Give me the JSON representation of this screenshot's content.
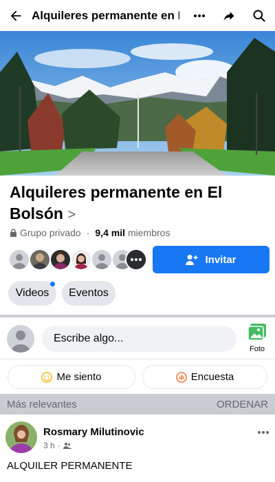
{
  "header": {
    "title": "Alquileres permanente en E...",
    "icons": [
      "back-arrow-icon",
      "more-dots-icon",
      "share-icon",
      "search-icon"
    ]
  },
  "group": {
    "name": "Alquileres permanente en El Bolsón",
    "chevron": ">",
    "privacy": "Grupo privado",
    "separator": "·",
    "member_count": "9,4 mil",
    "member_label": "miembros"
  },
  "invite_label": "Invitar",
  "tabs": [
    {
      "label": "Videos",
      "has_notification": true
    },
    {
      "label": "Eventos",
      "has_notification": false
    }
  ],
  "composer": {
    "placeholder": "Escribe algo...",
    "photo_label": "Foto"
  },
  "actions": {
    "feeling_label": "Me siento",
    "poll_label": "Encuesta"
  },
  "feed": {
    "sort_label": "Más relevantes",
    "sort_action": "ORDENAR"
  },
  "post": {
    "author": "Rosmary Milutinovic",
    "time": "3 h",
    "dot": "·",
    "text": "ALQUILER PERMANENTE"
  },
  "colors": {
    "brand_blue": "#1877f2",
    "secondary_text": "#65676b",
    "chip_bg": "#e4e6eb",
    "separator": "#c9ccd1"
  }
}
